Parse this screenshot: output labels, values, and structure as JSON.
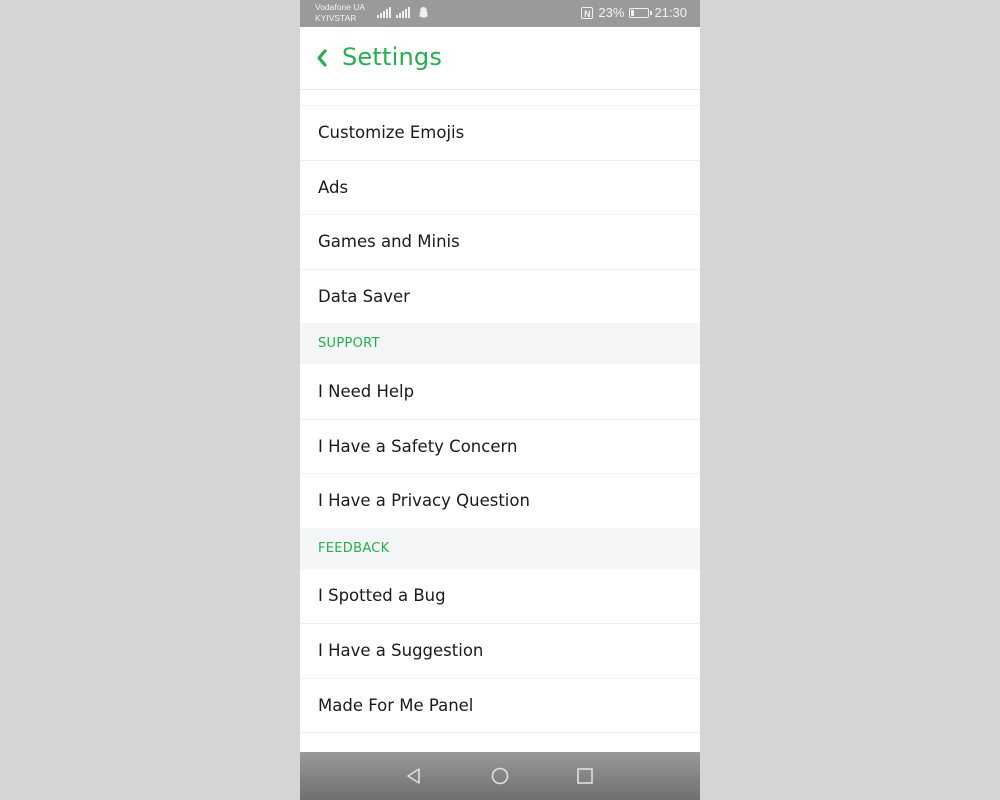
{
  "status_bar": {
    "carrier_1": "Vodafone UA",
    "carrier_2": "KYIVSTAR",
    "battery_percent": "23%",
    "battery_level": 0.23,
    "time": "21:30"
  },
  "header": {
    "title": "Settings",
    "back_icon": "chevron-left-icon"
  },
  "colors": {
    "accent": "#24b04b",
    "section_bg": "#f4f5f6",
    "status_bar": "#9a9a9a"
  },
  "groups": {
    "top_items": [
      "Customize Emojis",
      "Ads",
      "Games and Minis",
      "Data Saver"
    ],
    "support": {
      "title": "SUPPORT",
      "items": [
        "I Need Help",
        "I Have a Safety Concern",
        "I Have a Privacy Question"
      ]
    },
    "feedback": {
      "title": "FEEDBACK",
      "items": [
        "I Spotted a Bug",
        "I Have a Suggestion",
        "Made For Me Panel"
      ]
    }
  },
  "nav_bar": {
    "icons": [
      "back-triangle-icon",
      "home-circle-icon",
      "recents-square-icon"
    ]
  }
}
